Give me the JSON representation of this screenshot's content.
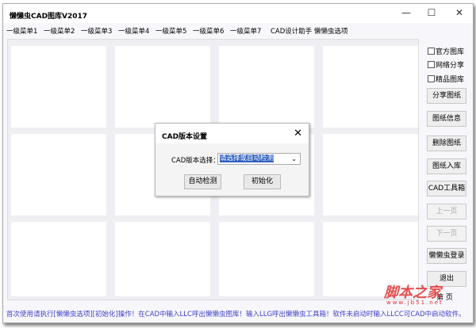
{
  "window": {
    "title": "懒懒虫CAD图库V2017",
    "minimize": "—",
    "maximize": "☐",
    "close": "✕"
  },
  "menu": [
    "一级菜单1",
    "一级菜单2",
    "一级菜单3",
    "一级菜单4",
    "一级菜单5",
    "一级菜单6",
    "一级菜单7",
    "CAD设计助手",
    "懒懒虫选项"
  ],
  "side": {
    "checkboxes": [
      {
        "label": "官方图库",
        "checked": false
      },
      {
        "label": "网络分享",
        "checked": false
      },
      {
        "label": "精品图库",
        "checked": false
      }
    ],
    "buttons": [
      {
        "label": "分享图纸",
        "enabled": true
      },
      {
        "label": "图纸信息",
        "enabled": true
      },
      {
        "label": "删除图纸",
        "enabled": true
      },
      {
        "label": "图纸入库",
        "enabled": true
      },
      {
        "label": "CAD工具箱",
        "enabled": true
      },
      {
        "label": "上一页",
        "enabled": false
      },
      {
        "label": "下一页",
        "enabled": false
      },
      {
        "label": "懒懒虫登录",
        "enabled": true
      },
      {
        "label": "退出",
        "enabled": true
      }
    ],
    "page_label": "第 页"
  },
  "dialog": {
    "title": "CAD版本设置",
    "close": "✕",
    "label": "CAD版本选择：",
    "select_value": "请选择或自动检测",
    "buttons": [
      "自动检测",
      "初始化"
    ]
  },
  "status": "首次使用请执行[懒懒虫选项][初始化]操作！在CAD中输入LLC呼出懒懒虫图库！输入LLG呼出懒懒虫工具箱！软件未启动时输入LLCC可CAD中启动软件。",
  "watermark": {
    "text": "脚本之家",
    "url": "www.jb51.net"
  }
}
